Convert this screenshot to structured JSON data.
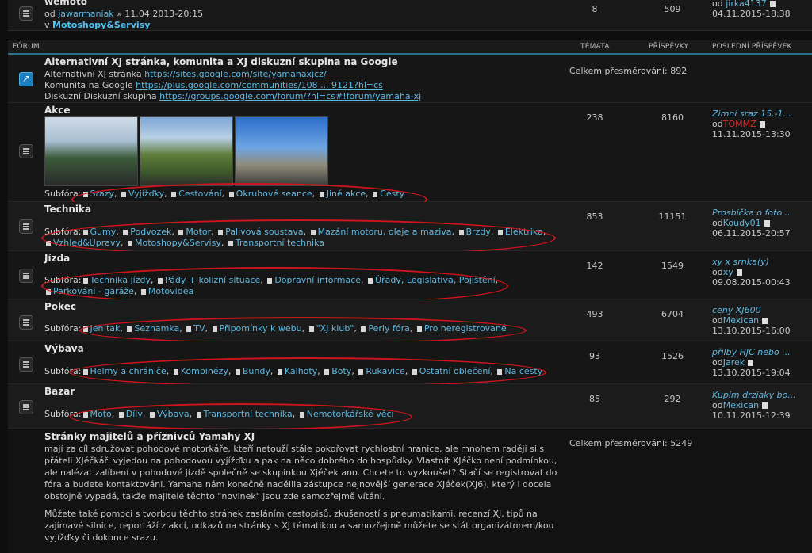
{
  "top_row": {
    "title": "wemoto",
    "by_prefix": "od",
    "author": "jawarmaniak",
    "date": "» 11.04.2013-20:15",
    "in_prefix": "v",
    "forum": "Motoshopy&Servisy",
    "topics": "8",
    "posts": "509",
    "last_by_prefix": "od",
    "last_user": "jirka4137",
    "last_date": "04.11.2015-18:38"
  },
  "header": {
    "forum": "FÓRUM",
    "topics": "TÉMATA",
    "posts": "PŘÍSPĚVKY",
    "last": "POSLEDNÍ PŘÍSPĚVEK"
  },
  "link_forum": {
    "title": "Alternativní XJ stránka, komunita a XJ diskuzní skupina na Google",
    "l1_label": "Alternativní XJ stránka",
    "l1_url": "https://sites.google.com/site/yamahaxjcz/",
    "l2_label": "Komunita na Google",
    "l2_url": "https://plus.google.com/communities/108 ... 9121?hl=cs",
    "l3_label": "Diskuzní Diskuzní skupina",
    "l3_url": "https://groups.google.com/forum/?hl=cs#!forum/yamaha-xj",
    "redirects": "Celkem přesměrování: 892"
  },
  "subforum_label": "Subfóra:",
  "forums": [
    {
      "title": "Akce",
      "sub_line1": [
        "Srazy",
        "Vyjížďky",
        "Cestování",
        "Okruhové seance",
        "Jiné akce",
        "Cesty"
      ],
      "sub_line2": [],
      "topics": "238",
      "posts": "8160",
      "last_title": "Zimní sraz 15.-1...",
      "last_by": "od",
      "last_user": "TOMMZ",
      "last_date": "11.11.2015-13:30"
    },
    {
      "title": "Technika",
      "sub_line1": [
        "Gumy",
        "Podvozek",
        "Motor",
        "Palivová soustava",
        "Mazání motoru, oleje a maziva",
        "Brzdy",
        "Elektrika"
      ],
      "sub_line2": [
        "Vzhled&Úpravy",
        "Motoshopy&Servisy",
        "Transportní technika"
      ],
      "topics": "853",
      "posts": "11151",
      "last_title": "Prosbička o foto...",
      "last_by": "od",
      "last_user": "Koudy01",
      "last_date": "06.11.2015-20:57"
    },
    {
      "title": "Jízda",
      "sub_line1": [
        "Technika jízdy",
        "Pády + kolizní situace",
        "Dopravní informace",
        "Úřady, Legislativa, Pojištění"
      ],
      "sub_line2": [
        "Parkování - garáže",
        "Motovidea"
      ],
      "topics": "142",
      "posts": "1549",
      "last_title": "xy x srnka(y)",
      "last_by": "od",
      "last_user": "xy",
      "last_date": "09.08.2015-00:43"
    },
    {
      "title": "Pokec",
      "sub_line1": [
        "Jen tak",
        "Seznamka",
        "TV",
        "Připomínky k webu",
        "\"XJ klub\"",
        "Perly fóra",
        "Pro neregistrované"
      ],
      "sub_line2": [],
      "topics": "493",
      "posts": "6704",
      "last_title": "ceny XJ600",
      "last_by": "od",
      "last_user": "Mexican",
      "last_date": "13.10.2015-16:00"
    },
    {
      "title": "Výbava",
      "sub_line1": [
        "Helmy a chrániče",
        "Kombinézy",
        "Bundy",
        "Kalhoty",
        "Boty",
        "Rukavice",
        "Ostatní oblečení",
        "Na cesty"
      ],
      "sub_line2": [],
      "topics": "93",
      "posts": "1526",
      "last_title": "přilby HJC nebo ...",
      "last_by": "od",
      "last_user": "Jarek",
      "last_date": "13.10.2015-19:04"
    },
    {
      "title": "Bazar",
      "sub_line1": [
        "Moto",
        "Díly",
        "Výbava",
        "Transportní technika",
        "Nemotorkářské věci"
      ],
      "sub_line2": [],
      "topics": "85",
      "posts": "292",
      "last_title": "Kupim drziaky bo...",
      "last_by": "od",
      "last_user": "Mexican",
      "last_date": "10.11.2015-12:39"
    }
  ],
  "owners_forum": {
    "title": "Stránky majitelů a příznivců Yamahy XJ",
    "p1": "mají za cíl sdružovat pohodové motorkáře, kteří netouží stále pokořovat rychlostní hranice, ale mnohem raději si s přáteli XJéčkáři vyjedou na pohodovou vyjížďku a pak na něco dobrého do hospůdky. Vlastnit XJéčko není podmínkou, ale nalézat zalíbení v pohodové jízdě společně se skupinkou Xjéček ano. Chcete to vyzkoušet? Stačí se registrovat do fóra a budete kontaktováni. Yamaha nám konečně nadělila zástupce nejnovější generace XJéček(XJ6), který i docela obstojně vypadá, takže majitelé těchto \"novinek\" jsou zde samozřejmě vítáni.",
    "p2": "Můžete také pomoci s tvorbou těchto stránek zasláním cestopisů, zkušeností s pneumatikami, recenzí XJ, tipů na zajímavé silnice, reportáží z akcí, odkazů na stránky s XJ tématikou a samozřejmě můžete se stát organizátorem/kou vyjížďky či dokonce srazu.",
    "redirects": "Celkem přesměrování: 5249"
  },
  "colors": {
    "link": "#5fb8e0",
    "accent_border": "#2a6f8a",
    "annotation": "#d0141c",
    "highlight_user": "#d32f2f"
  }
}
